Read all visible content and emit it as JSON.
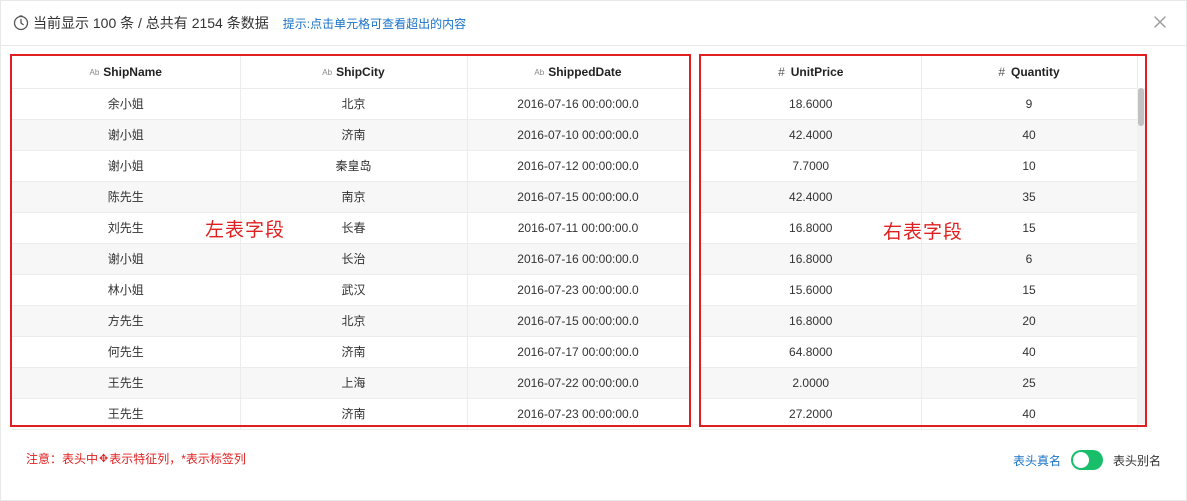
{
  "header": {
    "summary": "当前显示 100 条 / 总共有 2154 条数据",
    "hint": "提示:点击单元格可查看超出的内容"
  },
  "left_table": {
    "columns": [
      "ShipName",
      "ShipCity",
      "ShippedDate"
    ],
    "column_icon": "Ab",
    "rows": [
      [
        "余小姐",
        "北京",
        "2016-07-16 00:00:00.0"
      ],
      [
        "谢小姐",
        "济南",
        "2016-07-10 00:00:00.0"
      ],
      [
        "谢小姐",
        "秦皇岛",
        "2016-07-12 00:00:00.0"
      ],
      [
        "陈先生",
        "南京",
        "2016-07-15 00:00:00.0"
      ],
      [
        "刘先生",
        "长春",
        "2016-07-11 00:00:00.0"
      ],
      [
        "谢小姐",
        "长治",
        "2016-07-16 00:00:00.0"
      ],
      [
        "林小姐",
        "武汉",
        "2016-07-23 00:00:00.0"
      ],
      [
        "方先生",
        "北京",
        "2016-07-15 00:00:00.0"
      ],
      [
        "何先生",
        "济南",
        "2016-07-17 00:00:00.0"
      ],
      [
        "王先生",
        "上海",
        "2016-07-22 00:00:00.0"
      ],
      [
        "王先生",
        "济南",
        "2016-07-23 00:00:00.0"
      ]
    ]
  },
  "right_table": {
    "columns": [
      "UnitPrice",
      "Quantity"
    ],
    "column_icon": "#",
    "rows": [
      [
        "18.6000",
        "9"
      ],
      [
        "42.4000",
        "40"
      ],
      [
        "7.7000",
        "10"
      ],
      [
        "42.4000",
        "35"
      ],
      [
        "16.8000",
        "15"
      ],
      [
        "16.8000",
        "6"
      ],
      [
        "15.6000",
        "15"
      ],
      [
        "16.8000",
        "20"
      ],
      [
        "64.8000",
        "40"
      ],
      [
        "2.0000",
        "25"
      ],
      [
        "27.2000",
        "40"
      ]
    ]
  },
  "annotations": {
    "left_label": "左表字段",
    "right_label": "右表字段"
  },
  "footer": {
    "note_prefix": "注意：表头中",
    "note_suffix": "表示特征列，*表示标签列",
    "toggle_left": "表头真名",
    "toggle_right": "表头别名",
    "toggle_on": true
  },
  "colors": {
    "accent": "#1a73c7",
    "alert": "#e02020",
    "switch_on": "#19be6b"
  }
}
